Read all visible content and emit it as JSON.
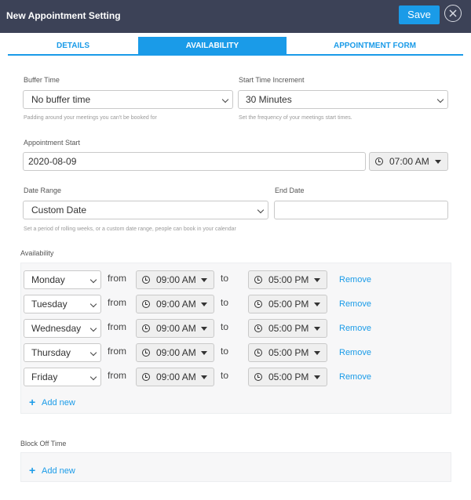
{
  "header": {
    "title": "New Appointment Setting",
    "save_label": "Save"
  },
  "tabs": [
    {
      "label": "DETAILS",
      "active": false
    },
    {
      "label": "AVAILABILITY",
      "active": true
    },
    {
      "label": "APPOINTMENT FORM",
      "active": false
    }
  ],
  "buffer_time": {
    "label": "Buffer Time",
    "value": "No buffer time",
    "help": "Padding around your meetings you can't be booked for"
  },
  "start_increment": {
    "label": "Start Time Increment",
    "value": "30 Minutes",
    "help": "Set the frequency of your meetings start times."
  },
  "appointment_start": {
    "label": "Appointment Start",
    "date": "2020-08-09",
    "time": "07:00 AM"
  },
  "date_range": {
    "label": "Date Range",
    "value": "Custom Date",
    "help": "Set a period of rolling weeks, or a custom date range, people can book in your calendar"
  },
  "end_date": {
    "label": "End Date",
    "value": ""
  },
  "availability": {
    "label": "Availability",
    "from_word": "from",
    "to_word": "to",
    "remove_label": "Remove",
    "add_label": "Add new",
    "rows": [
      {
        "day": "Monday",
        "from": "09:00 AM",
        "to": "05:00 PM"
      },
      {
        "day": "Tuesday",
        "from": "09:00 AM",
        "to": "05:00 PM"
      },
      {
        "day": "Wednesday",
        "from": "09:00 AM",
        "to": "05:00 PM"
      },
      {
        "day": "Thursday",
        "from": "09:00 AM",
        "to": "05:00 PM"
      },
      {
        "day": "Friday",
        "from": "09:00 AM",
        "to": "05:00 PM"
      }
    ]
  },
  "block_off": {
    "label": "Block Off Time",
    "add_label": "Add new"
  },
  "colors": {
    "header_bg": "#3c4257",
    "accent": "#1a9be8"
  }
}
